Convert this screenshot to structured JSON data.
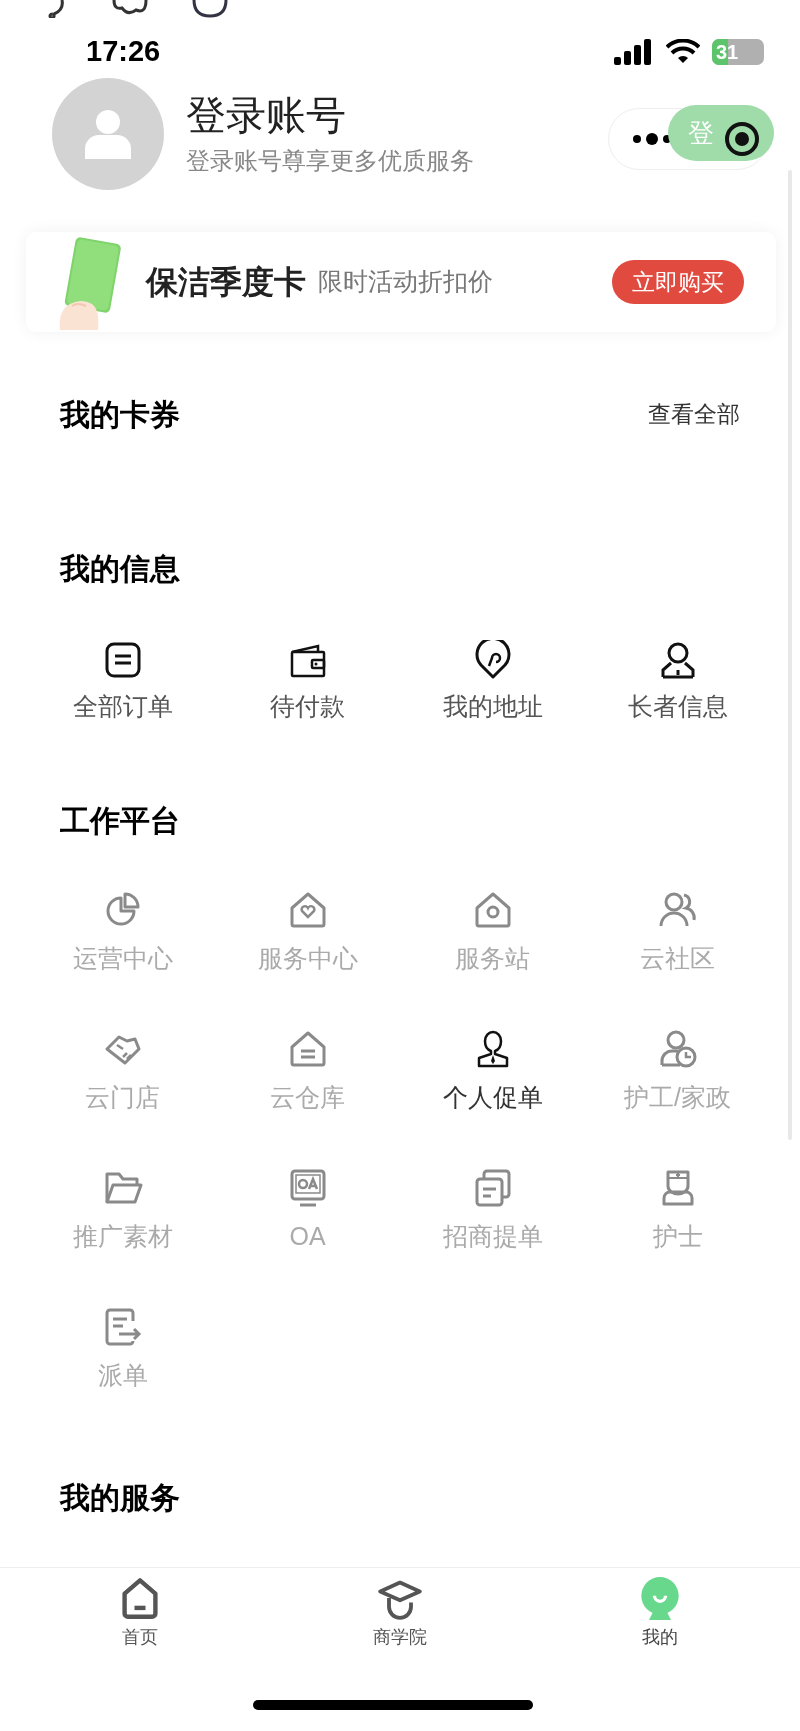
{
  "status_bar": {
    "time": "17:26",
    "battery": "31"
  },
  "profile": {
    "title": "登录账号",
    "subtitle": "登录账号尊享更多优质服务",
    "login_button": "登"
  },
  "banner": {
    "title": "保洁季度卡",
    "subtitle": "限时活动折扣价",
    "button": "立即购买"
  },
  "cards": {
    "title": "我的卡券",
    "link": "查看全部"
  },
  "info": {
    "title": "我的信息",
    "items": [
      {
        "label": "全部订单"
      },
      {
        "label": "待付款"
      },
      {
        "label": "我的地址"
      },
      {
        "label": "长者信息"
      }
    ]
  },
  "work": {
    "title": "工作平台",
    "items": [
      {
        "label": "运营中心",
        "disabled": true
      },
      {
        "label": "服务中心",
        "disabled": true
      },
      {
        "label": "服务站",
        "disabled": true
      },
      {
        "label": "云社区",
        "disabled": true
      },
      {
        "label": "云门店",
        "disabled": true
      },
      {
        "label": "云仓库",
        "disabled": true
      },
      {
        "label": "个人促单",
        "disabled": false
      },
      {
        "label": "护工/家政",
        "disabled": true
      },
      {
        "label": "推广素材",
        "disabled": true
      },
      {
        "label": "OA",
        "disabled": true
      },
      {
        "label": "招商提单",
        "disabled": true
      },
      {
        "label": "护士",
        "disabled": true
      },
      {
        "label": "派单",
        "disabled": true
      }
    ]
  },
  "services": {
    "title": "我的服务"
  },
  "tab_bar": [
    {
      "label": "首页",
      "selected": false
    },
    {
      "label": "商学院",
      "selected": false
    },
    {
      "label": "我的",
      "selected": true
    }
  ]
}
